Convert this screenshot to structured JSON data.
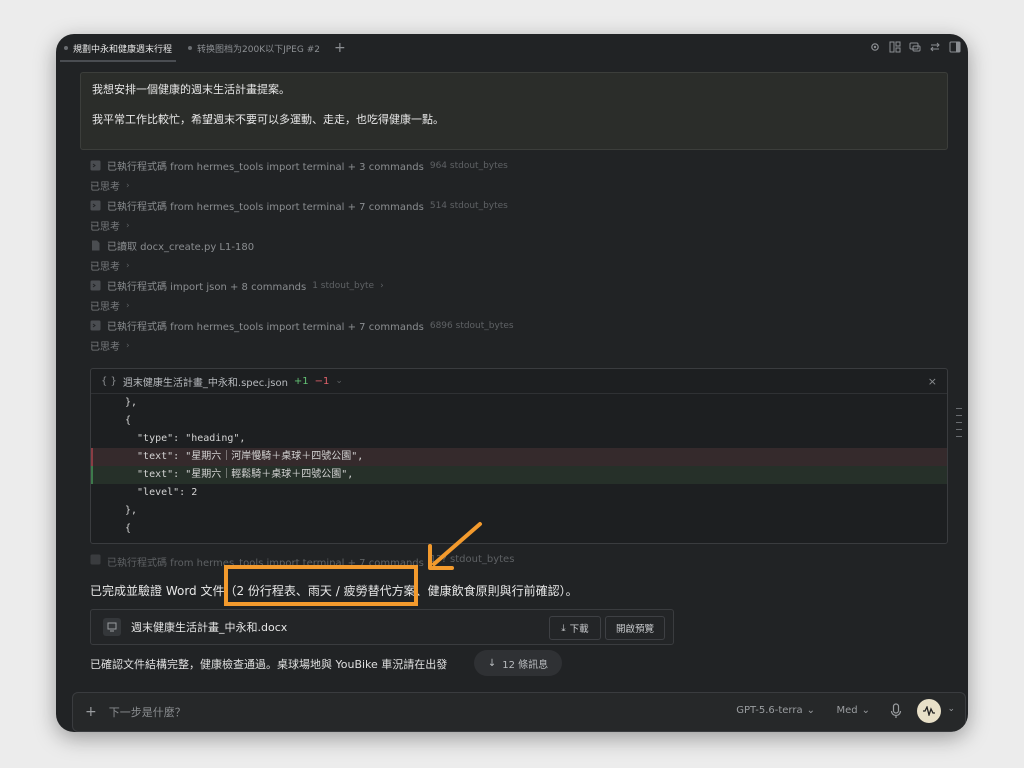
{
  "tabs": [
    {
      "label": "規劃中永和健康週末行程",
      "active": true
    },
    {
      "label": "转换图档为200K以下JPEG #2",
      "active": false
    }
  ],
  "prompt": {
    "line1": "我想安排一個健康的週末生活計畫提案。",
    "line2": "我平常工作比較忙，希望週末不要可以多運動、走走，也吃得健康一點。"
  },
  "log": [
    {
      "icon": "terminal-icon",
      "text": "已執行程式碼 from hermes_tools import terminal + 3 commands",
      "bytes": "964 stdout_bytes"
    },
    {
      "icon": "terminal-icon",
      "text": "已執行程式碼 from hermes_tools import terminal + 7 commands",
      "bytes": "514 stdout_bytes"
    },
    {
      "icon": "file-icon",
      "text": "已讀取 docx_create.py L1-180",
      "bytes": ""
    },
    {
      "icon": "terminal-icon",
      "text": "已執行程式碼 import json + 8 commands",
      "bytes": "1 stdout_byte"
    },
    {
      "icon": "terminal-icon",
      "text": "已執行程式碼 from hermes_tools import terminal + 7 commands",
      "bytes": "6896 stdout_bytes"
    }
  ],
  "thought_label": "已思考",
  "code_panel": {
    "filename": "週末健康生活計畫_中永和.spec.json",
    "added": "+1",
    "removed": "−1",
    "lines": [
      {
        "text": "},",
        "type": "normal"
      },
      {
        "text": "{",
        "type": "normal"
      },
      {
        "text": "  \"type\": \"heading\",",
        "type": "normal"
      },
      {
        "text": "  \"text\": \"星期六｜河岸慢騎＋桌球＋四號公園\",",
        "type": "del"
      },
      {
        "text": "  \"text\": \"星期六｜輕鬆騎＋桌球＋四號公園\",",
        "type": "add"
      },
      {
        "text": "  \"level\": 2",
        "type": "normal"
      },
      {
        "text": "},",
        "type": "normal"
      },
      {
        "text": "{",
        "type": "normal"
      }
    ]
  },
  "faded_log": {
    "text": "已執行程式碼 from hermes_tools import terminal + 7 commands",
    "bytes": "1?? stdout_bytes"
  },
  "summary": "已完成並驗證 Word 文件（2 份行程表、雨天 / 疲勞替代方案、健康飲食原則與行前確認）。",
  "file_card": {
    "name": "週末健康生活計畫_中永和.docx",
    "download_label": "下載",
    "preview_label": "開啟預覽"
  },
  "confirm_text": "已確認文件結構完整，健康檢查通過。桌球場地與 YouBike 車況請在出發",
  "messages_pill": "12 條訊息",
  "composer": {
    "placeholder": "下一步是什麼？",
    "model": "GPT-5.6-terra",
    "effort": "Med"
  },
  "colors": {
    "highlight": "#f39a2d",
    "added": "#63c174",
    "removed": "#e0616a"
  }
}
